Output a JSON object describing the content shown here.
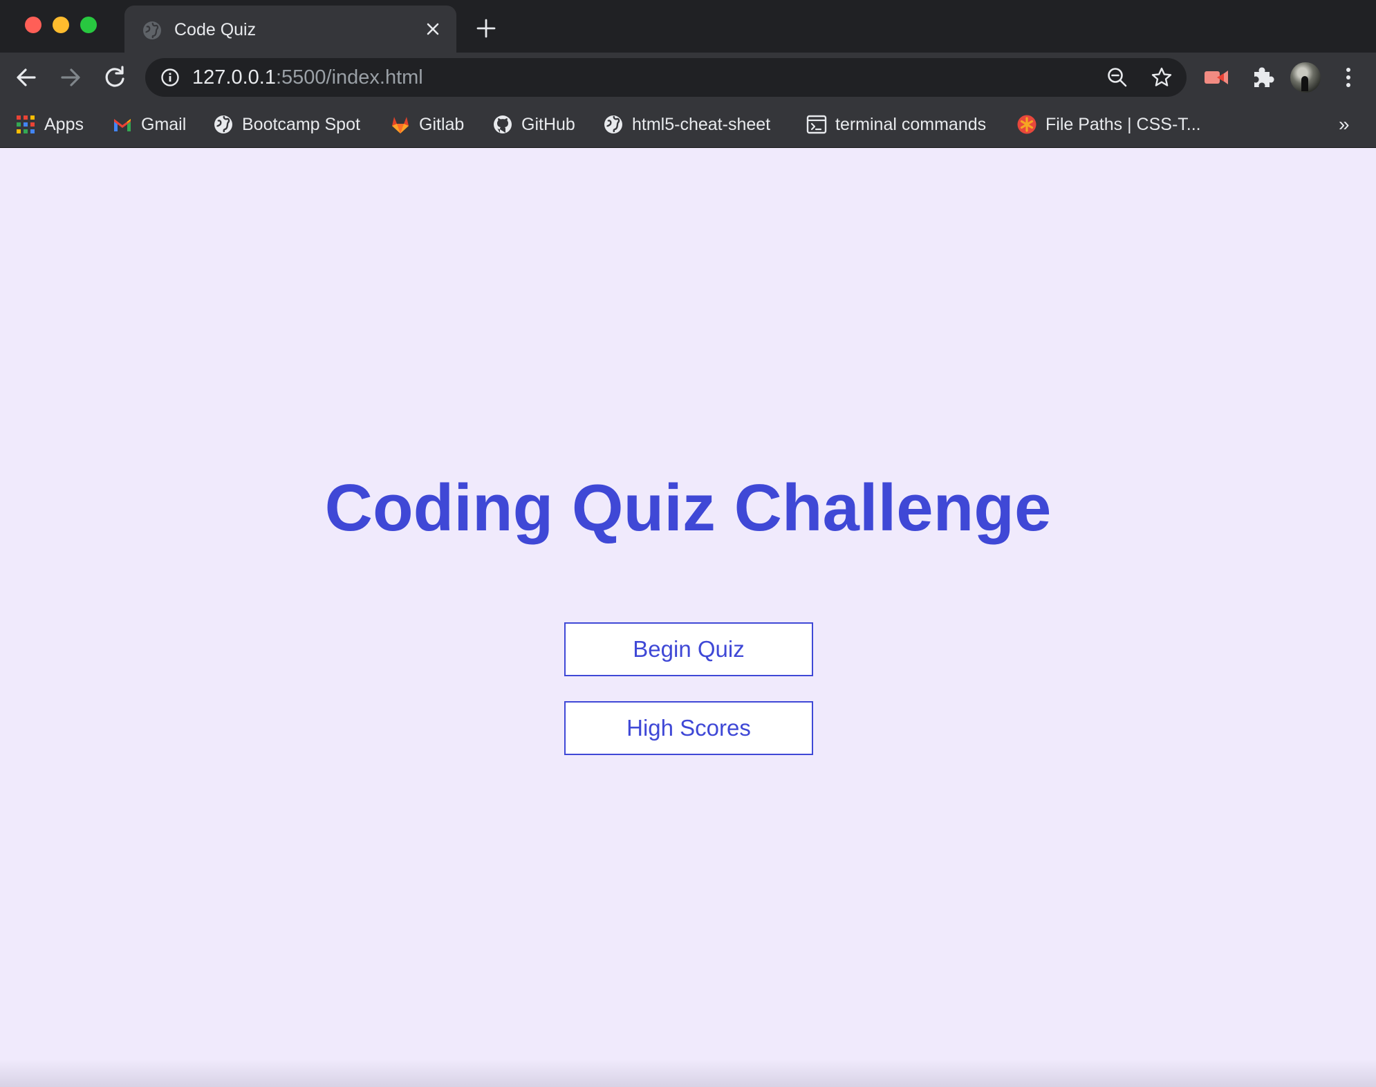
{
  "browser": {
    "tab": {
      "title": "Code Quiz",
      "favicon": "globe-icon",
      "close_icon": "close-icon"
    },
    "new_tab_icon": "plus-icon",
    "nav": {
      "back_icon": "arrow-left-icon",
      "forward_icon": "arrow-right-icon",
      "reload_icon": "reload-icon"
    },
    "omnibox": {
      "info_icon": "info-icon",
      "url_host": "127.0.0.1",
      "url_rest": ":5500/index.html",
      "zoom_icon": "zoom-out-icon",
      "bookmark_icon": "star-icon"
    },
    "extensions": [
      "video-extension-icon",
      "puzzle-icon"
    ],
    "menu_icon": "more-vertical-icon",
    "bookmarks": [
      {
        "label": "Apps",
        "icon": "apps-grid-icon"
      },
      {
        "label": "Gmail",
        "icon": "gmail-icon"
      },
      {
        "label": "Bootcamp Spot",
        "icon": "globe-icon"
      },
      {
        "label": "Gitlab",
        "icon": "gitlab-icon"
      },
      {
        "label": "GitHub",
        "icon": "github-icon"
      },
      {
        "label": "html5-cheat-sheet",
        "icon": "globe-icon"
      },
      {
        "label": "terminal commands",
        "icon": "terminal-icon"
      },
      {
        "label": "File Paths | CSS-T...",
        "icon": "css-tricks-icon"
      }
    ],
    "bookmarks_overflow": "»"
  },
  "page": {
    "title": "Coding Quiz Challenge",
    "begin_button": "Begin Quiz",
    "scores_button": "High Scores"
  },
  "colors": {
    "accent": "#3f48d6",
    "page_background": "#f0eafc",
    "chrome_dark": "#202124",
    "chrome_toolbar": "#35363a"
  }
}
